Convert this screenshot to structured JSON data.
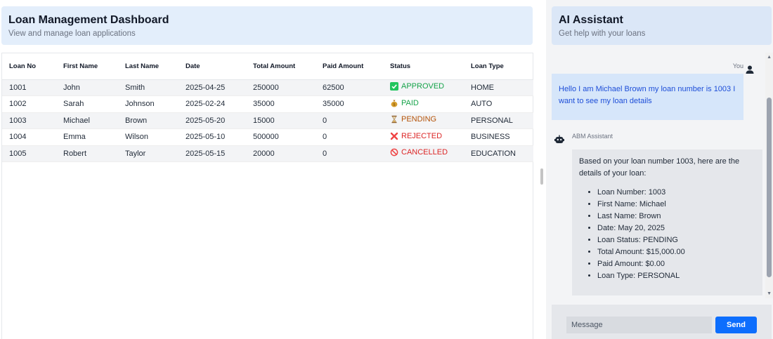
{
  "dashboard": {
    "title": "Loan Management Dashboard",
    "subtitle": "View and manage loan applications"
  },
  "table": {
    "headers": [
      "Loan No",
      "First Name",
      "Last Name",
      "Date",
      "Total Amount",
      "Paid Amount",
      "Status",
      "Loan Type"
    ],
    "rows": [
      {
        "loan_no": "1001",
        "first": "John",
        "last": "Smith",
        "date": "2025-04-25",
        "total": "250000",
        "paid": "62500",
        "status": "APPROVED",
        "status_icon": "check-icon",
        "type": "HOME"
      },
      {
        "loan_no": "1002",
        "first": "Sarah",
        "last": "Johnson",
        "date": "2025-02-24",
        "total": "35000",
        "paid": "35000",
        "status": "PAID",
        "status_icon": "money-bag-icon",
        "type": "AUTO"
      },
      {
        "loan_no": "1003",
        "first": "Michael",
        "last": "Brown",
        "date": "2025-05-20",
        "total": "15000",
        "paid": "0",
        "status": "PENDING",
        "status_icon": "hourglass-icon",
        "type": "PERSONAL"
      },
      {
        "loan_no": "1004",
        "first": "Emma",
        "last": "Wilson",
        "date": "2025-05-10",
        "total": "500000",
        "paid": "0",
        "status": "REJECTED",
        "status_icon": "cross-icon",
        "type": "BUSINESS"
      },
      {
        "loan_no": "1005",
        "first": "Robert",
        "last": "Taylor",
        "date": "2025-05-15",
        "total": "20000",
        "paid": "0",
        "status": "CANCELLED",
        "status_icon": "prohibited-icon",
        "type": "EDUCATION"
      }
    ]
  },
  "assistant": {
    "title": "AI Assistant",
    "subtitle": "Get help with your loans",
    "you_label": "You",
    "user_message": "Hello I am Michael Brown my loan number is 1003 I want to see my loan details",
    "bot_label": "ABM Assistant",
    "bot_intro": "Based on your loan number 1003, here are the details of your loan:",
    "bot_items": [
      "Loan Number: 1003",
      "First Name: Michael",
      "Last Name: Brown",
      "Date: May 20, 2025",
      "Loan Status: PENDING",
      "Total Amount: $15,000.00",
      "Paid Amount: $0.00",
      "Loan Type: PERSONAL"
    ],
    "input_placeholder": "Message",
    "send_label": "Send"
  },
  "colors": {
    "accent": "#0d6efd",
    "approved": "#16a34a",
    "pending": "#b45309",
    "rejected": "#dc2626"
  }
}
